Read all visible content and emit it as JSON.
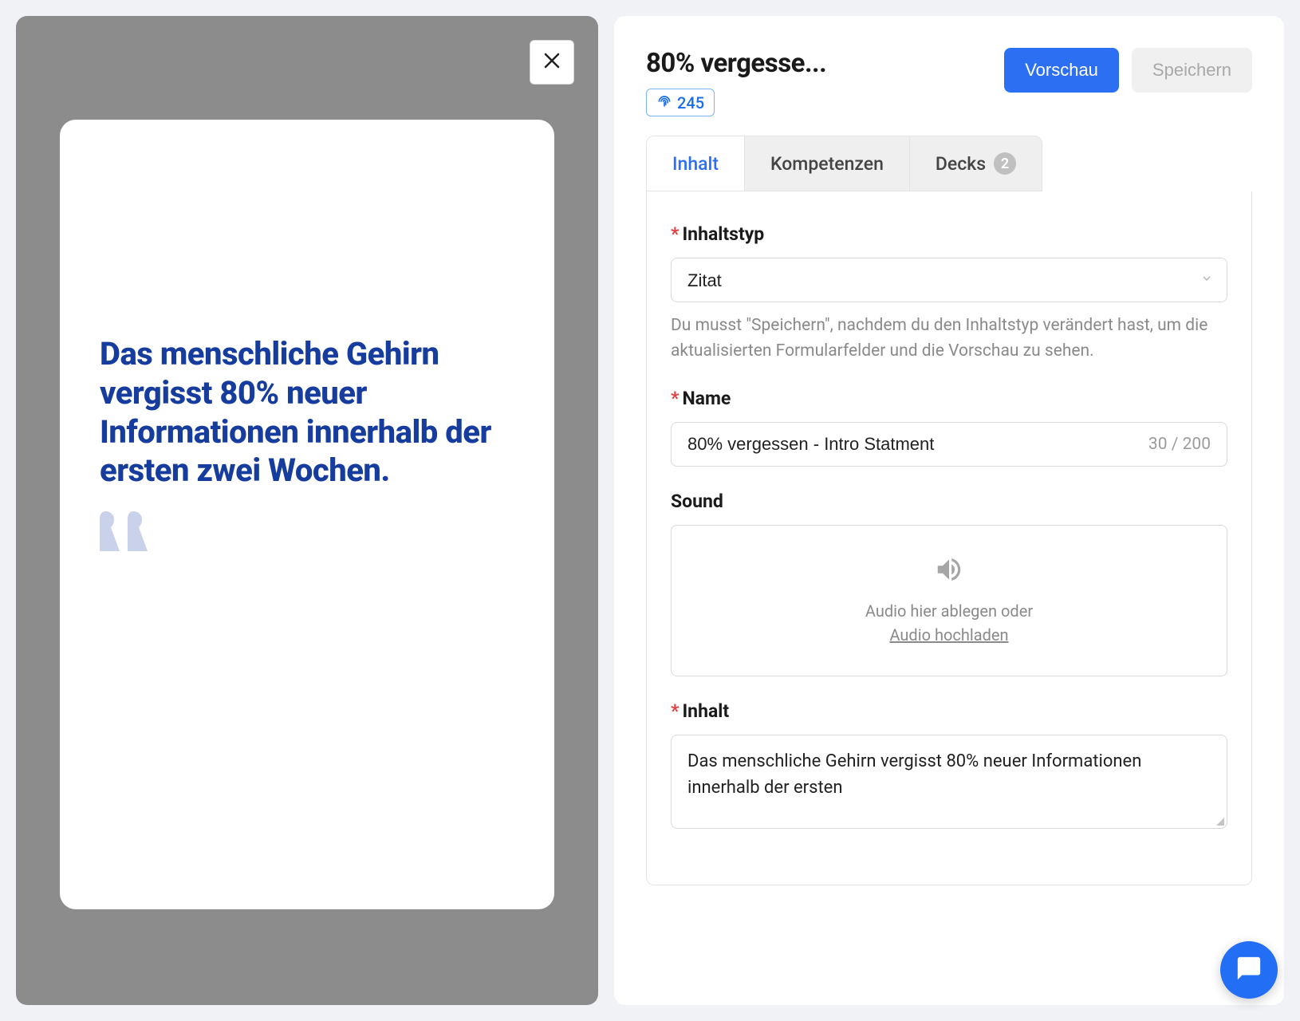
{
  "preview": {
    "quote_text": "Das menschliche Ge­hirn vergisst 80% neu­er Informationen in­nerhalb der ersten zwei Wochen."
  },
  "header": {
    "title": "80% vergesse...",
    "id_value": "245",
    "actions": {
      "preview": "Vorschau",
      "save": "Speichern"
    }
  },
  "tabs": {
    "content": "Inhalt",
    "competencies": "Kompetenzen",
    "decks": "Decks",
    "decks_count": "2"
  },
  "form": {
    "content_type": {
      "label": "Inhaltstyp",
      "value": "Zitat",
      "helper": "Du musst \"Speichern\", nachdem du den Inhaltstyp verändert hast, um die aktualisierten Formularfelder und die Vorschau zu sehen."
    },
    "name": {
      "label": "Name",
      "value": "80% vergessen - Intro Statment",
      "count": "30 / 200"
    },
    "sound": {
      "label": "Sound",
      "drop_text": "Audio hier ablegen oder",
      "link_text": "Audio hochladen"
    },
    "content": {
      "label": "Inhalt",
      "value": "Das menschliche Gehirn vergisst 80% neuer Informationen innerhalb der ersten "
    }
  }
}
